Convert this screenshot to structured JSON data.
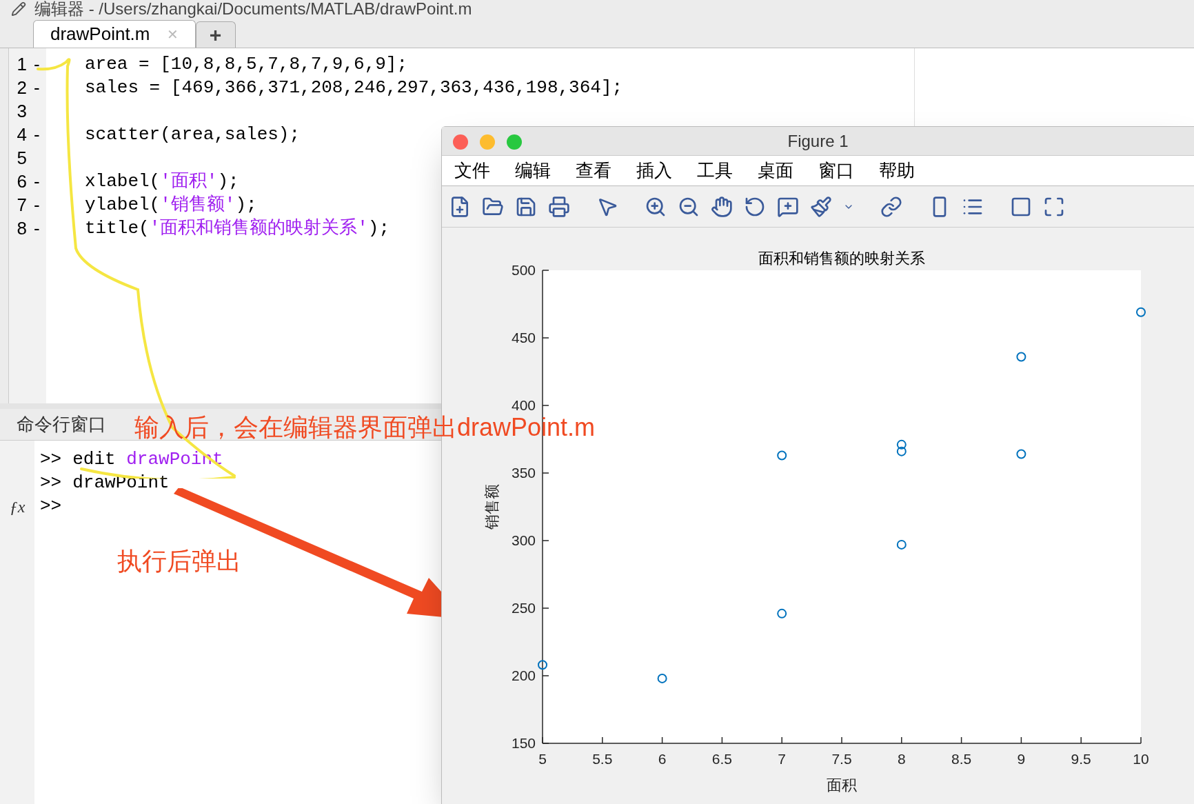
{
  "editor": {
    "title": "编辑器 - /Users/zhangkai/Documents/MATLAB/drawPoint.m",
    "tabs": [
      {
        "label": "drawPoint.m",
        "selected": true
      }
    ],
    "add_tab": "+",
    "tab_close": "✕",
    "lines": [
      {
        "number": "1",
        "marker": "-",
        "segments": [
          {
            "kind": "plain",
            "text": "area = [10,8,8,5,7,8,7,9,6,9];"
          }
        ]
      },
      {
        "number": "2",
        "marker": "-",
        "segments": [
          {
            "kind": "plain",
            "text": "sales = [469,366,371,208,246,297,363,436,198,364];"
          }
        ]
      },
      {
        "number": "3"
      },
      {
        "number": "4",
        "marker": "-",
        "segments": [
          {
            "kind": "plain",
            "text": "scatter(area,sales);"
          }
        ]
      },
      {
        "number": "5"
      },
      {
        "number": "6",
        "marker": "-",
        "segments": [
          {
            "kind": "plain",
            "text": "xlabel("
          },
          {
            "kind": "string",
            "text": "'面积'"
          },
          {
            "kind": "plain",
            "text": ");"
          }
        ]
      },
      {
        "number": "7",
        "marker": "-",
        "segments": [
          {
            "kind": "plain",
            "text": "ylabel("
          },
          {
            "kind": "string",
            "text": "'销售额'"
          },
          {
            "kind": "plain",
            "text": ");"
          }
        ]
      },
      {
        "number": "8",
        "marker": "-",
        "segments": [
          {
            "kind": "plain",
            "text": "title("
          },
          {
            "kind": "string",
            "text": "'面积和销售额的映射关系'"
          },
          {
            "kind": "plain",
            "text": ");"
          }
        ]
      }
    ]
  },
  "command_window": {
    "title": "命令行窗口",
    "function_icon": "ƒx",
    "lines": [
      {
        "prompt": ">>",
        "segments": [
          {
            "kind": "plain",
            "text": "edit "
          },
          {
            "kind": "string",
            "text": "drawPoint"
          }
        ]
      },
      {
        "prompt": ">>",
        "segments": [
          {
            "kind": "plain",
            "text": "drawPoint"
          }
        ]
      },
      {
        "prompt": ">>"
      }
    ]
  },
  "figure": {
    "title": "Figure 1",
    "menu": [
      "文件",
      "编辑",
      "查看",
      "插入",
      "工具",
      "桌面",
      "窗口",
      "帮助"
    ],
    "chart_data": {
      "type": "scatter",
      "title": "面积和销售额的映射关系",
      "xlabel": "面积",
      "ylabel": "销售额",
      "series": [
        {
          "color": "#0072bd",
          "x": [
            10,
            8,
            8,
            5,
            7,
            8,
            7,
            9,
            6,
            9
          ],
          "values": [
            469,
            366,
            371,
            208,
            246,
            297,
            363,
            436,
            198,
            364
          ]
        }
      ],
      "xlim": [
        5,
        10
      ],
      "ylim": [
        150,
        500
      ],
      "xticks": [
        5,
        5.5,
        6,
        6.5,
        7,
        7.5,
        8,
        8.5,
        9,
        9.5,
        10
      ],
      "yticks": [
        150,
        200,
        250,
        300,
        350,
        400,
        450,
        500
      ]
    }
  },
  "annotations": [
    {
      "kind": "note",
      "text": "输入后，会在编辑器界面弹出drawPoint.m"
    },
    {
      "kind": "note",
      "text": "执行后弹出"
    }
  ]
}
